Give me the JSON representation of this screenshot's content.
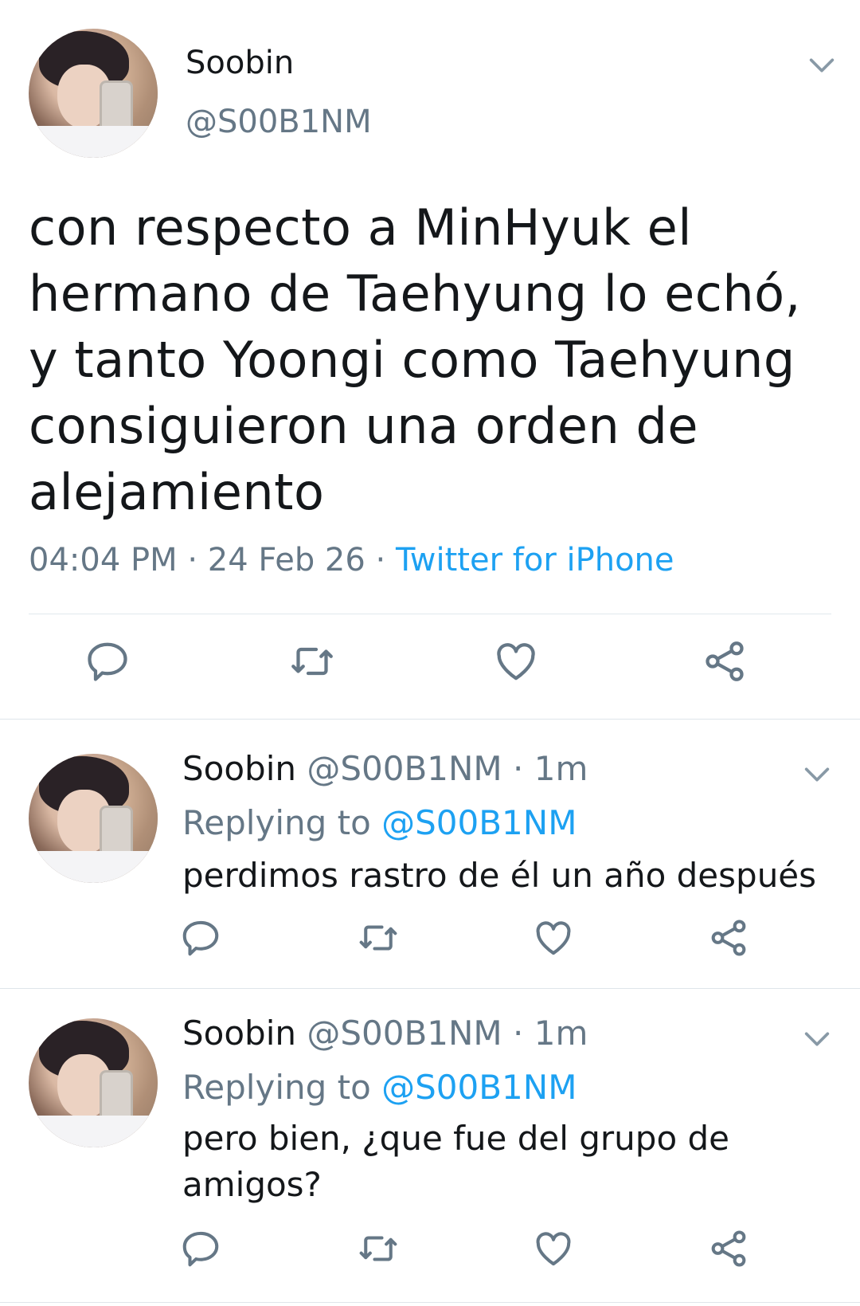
{
  "main_tweet": {
    "name": "Soobin",
    "handle": "@S00B1NM",
    "text": "con respecto a MinHyuk el hermano de Taehyung lo echó, y tanto Yoongi como Taehyung consiguieron una orden de alejamiento",
    "time": "04:04 PM",
    "sep1": " · ",
    "date": "24 Feb 26",
    "sep2": " · ",
    "source": "Twitter for iPhone"
  },
  "replies": [
    {
      "name": "Soobin",
      "handle": "@S00B1NM",
      "dot": " · ",
      "age": "1m",
      "replying_label": "Replying to ",
      "replying_to": "@S00B1NM",
      "text": "perdimos rastro de él un año después"
    },
    {
      "name": "Soobin",
      "handle": "@S00B1NM",
      "dot": " · ",
      "age": "1m",
      "replying_label": "Replying to ",
      "replying_to": "@S00B1NM",
      "text": "pero bien, ¿que fue del grupo de amigos?"
    }
  ],
  "icons": [
    "reply-icon",
    "retweet-icon",
    "like-icon",
    "share-icon",
    "chevron-down-icon"
  ],
  "colors": {
    "text": "#14171a",
    "secondary": "#657786",
    "link": "#1da1f2",
    "icon": "#657786"
  }
}
